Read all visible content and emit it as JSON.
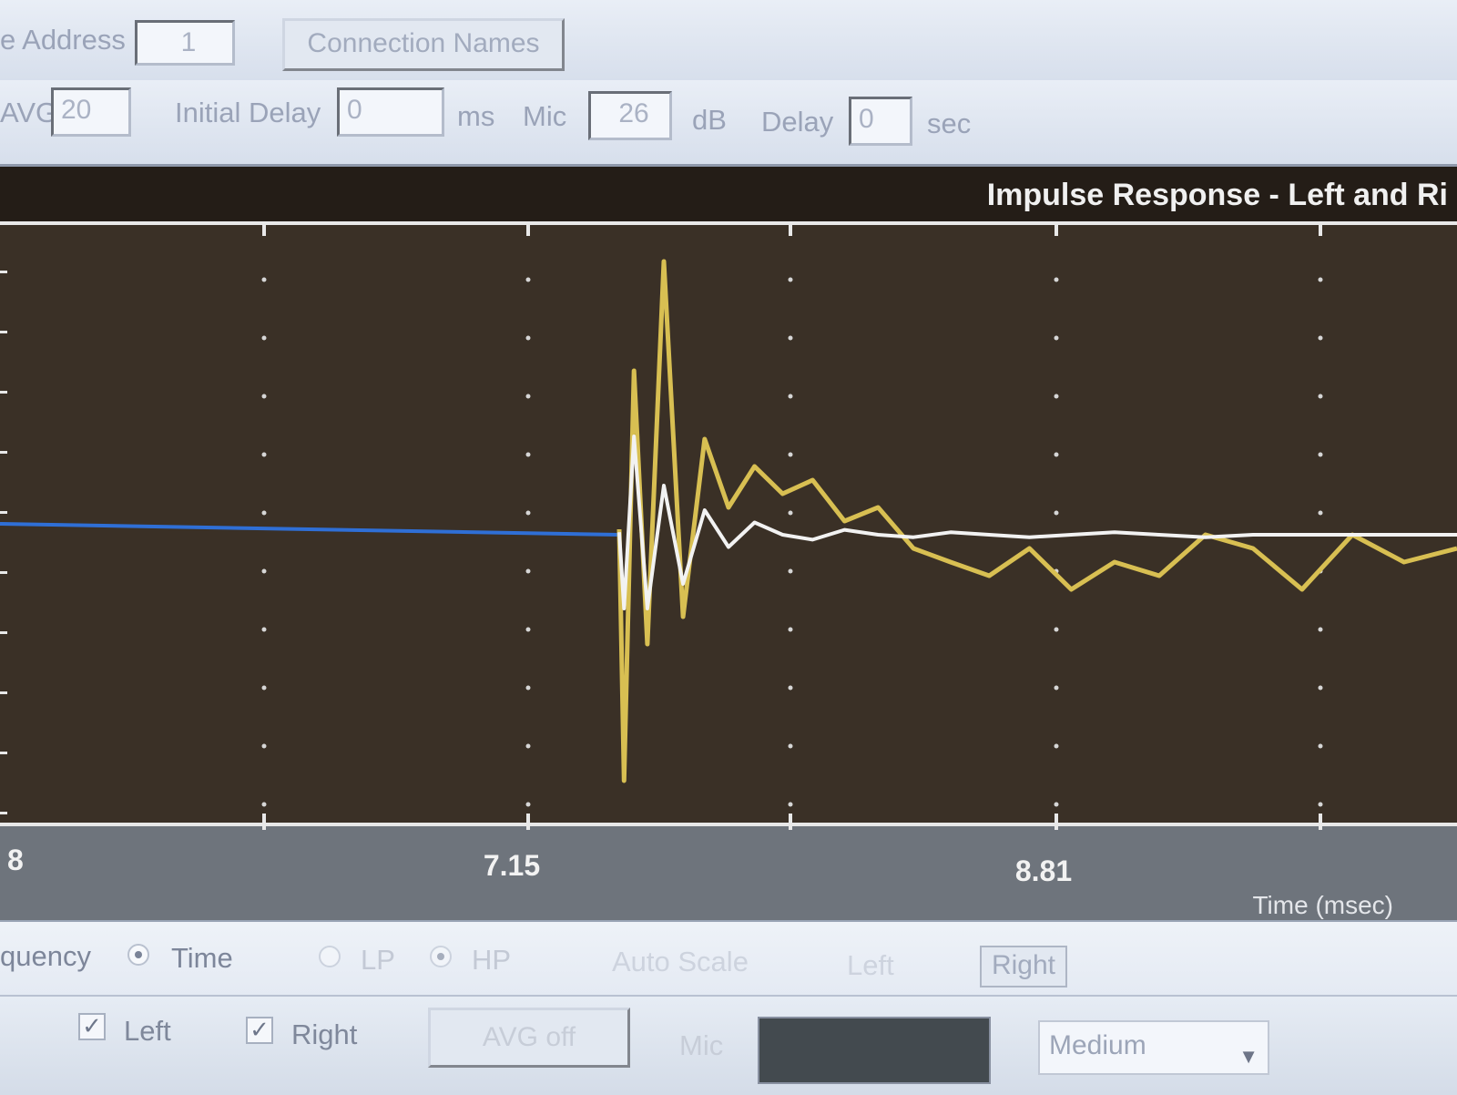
{
  "toolbar": {
    "address_label": "e Address",
    "address_value": "1",
    "connection_names_label": "Connection Names",
    "avg_label": "AVG",
    "avg_value": "20",
    "initial_delay_label": "Initial Delay",
    "initial_delay_value": "0",
    "initial_delay_unit": "ms",
    "mic_label": "Mic",
    "mic_value": "26",
    "mic_unit": "dB",
    "delay_label": "Delay",
    "delay_value": "0",
    "delay_unit": "sec"
  },
  "chart_data": {
    "type": "line",
    "title": "Impulse Response - Left and Ri",
    "xlabel": "Time (msec)",
    "x_tick_labels": [
      "8",
      "7.15",
      "8.81"
    ],
    "grid": "dotted",
    "colors": {
      "left": "#d8bf52",
      "right": "#f2f2f2",
      "overlap": "#2f6fd6",
      "background": "#3a3026"
    },
    "series": [
      {
        "values": [
          0,
          0,
          0,
          0,
          0.02,
          -0.9,
          0.6,
          -0.4,
          1.0,
          -0.3,
          0.35,
          0.1,
          0.25,
          0.15,
          0.2,
          0.05,
          0.1,
          -0.05,
          -0.1,
          -0.15,
          -0.05,
          -0.2,
          -0.1,
          -0.15,
          0.0,
          -0.05,
          -0.2,
          0.0,
          -0.1,
          -0.05
        ]
      },
      {
        "values": [
          0,
          0,
          0,
          0,
          0.01,
          -0.3,
          0.4,
          -0.3,
          0.2,
          -0.2,
          0.1,
          -0.05,
          0.05,
          0.0,
          -0.02,
          0.02,
          0.0,
          -0.01,
          0.01,
          0.0,
          -0.01,
          0.0,
          0.01,
          0.0,
          -0.01,
          0.0,
          0.0,
          0.0,
          0.0,
          0.0
        ]
      }
    ]
  },
  "controls": {
    "frequency_label": "quency",
    "time_label": "Time",
    "lp_label": "LP",
    "hp_label": "HP",
    "auto_scale_label": "Auto Scale",
    "left_btn_label": "Left",
    "right_btn_label": "Right",
    "left_check_label": "Left",
    "right_check_label": "Right",
    "avg_off_label": "AVG off",
    "mic_label": "Mic",
    "speed_value": "Medium"
  }
}
